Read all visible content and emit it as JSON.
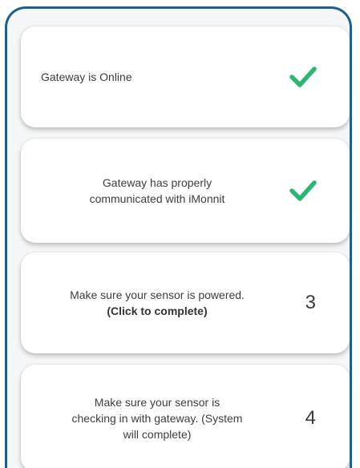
{
  "steps": [
    {
      "text": "Gateway is Online",
      "status": "complete",
      "icon": "checkmark-icon",
      "check_color": "#2bb673"
    },
    {
      "text": "Gateway has properly communicated with iMonnit",
      "status": "complete",
      "icon": "checkmark-icon",
      "check_color": "#2bb673"
    },
    {
      "text": "Make sure your sensor is powered.",
      "action": "(Click to complete)",
      "status": "pending",
      "number": "3"
    },
    {
      "text": "Make sure your sensor is checking in with gateway. (System will complete)",
      "status": "pending",
      "number": "4"
    }
  ],
  "colors": {
    "frame_border": "#1f5f8b",
    "success": "#2bb673"
  }
}
